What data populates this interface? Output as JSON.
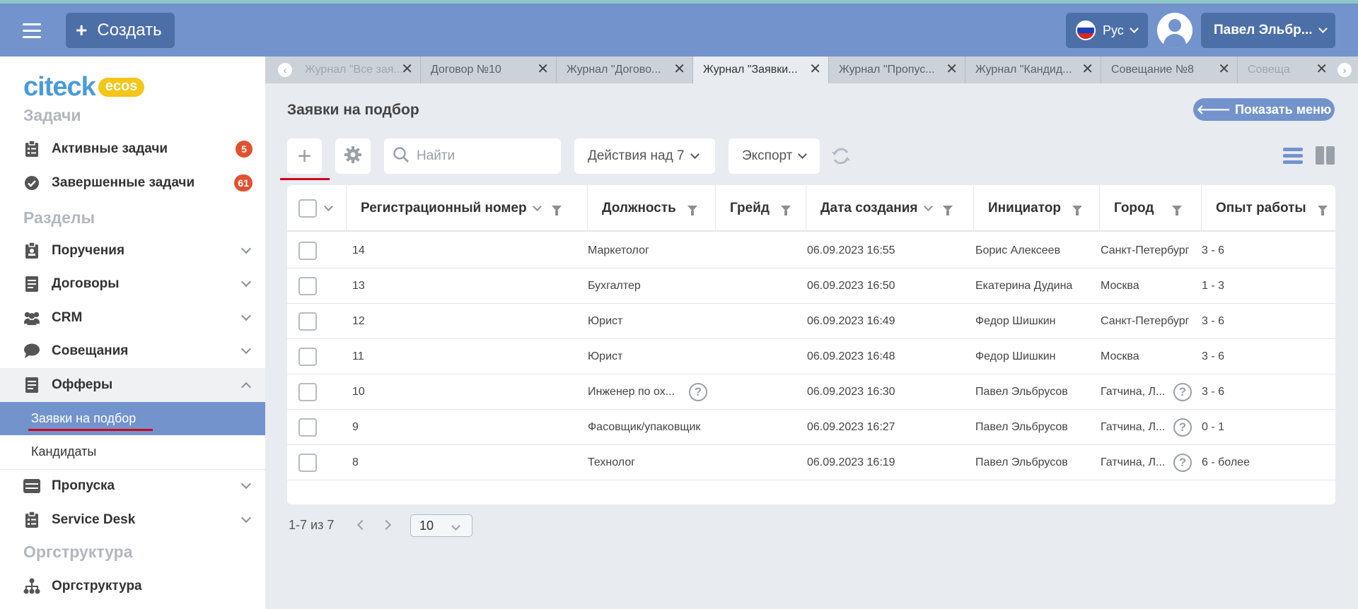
{
  "topbar": {
    "create_label": "Создать",
    "lang_label": "Рус",
    "user_label": "Павел Эльбр..."
  },
  "sidebar": {
    "logo_main": "citeck",
    "logo_badge": "ecos",
    "sections": {
      "tasks": "Задачи",
      "sections": "Разделы",
      "org": "Оргструктура"
    },
    "items": {
      "active_tasks": {
        "label": "Активные задачи",
        "badge": "5"
      },
      "done_tasks": {
        "label": "Завершенные задачи",
        "badge": "61"
      },
      "assignments": {
        "label": "Поручения"
      },
      "contracts": {
        "label": "Договоры"
      },
      "crm": {
        "label": "CRM"
      },
      "meetings": {
        "label": "Совещания"
      },
      "offers": {
        "label": "Офферы"
      },
      "requests": {
        "label": "Заявки на подбор"
      },
      "candidates": {
        "label": "Кандидаты"
      },
      "passes": {
        "label": "Пропуска"
      },
      "service_desk": {
        "label": "Service Desk"
      },
      "orgstructure": {
        "label": "Оргструктура"
      }
    }
  },
  "tabs": [
    {
      "label": "Журнал \"Все зая..."
    },
    {
      "label": "Договор №10"
    },
    {
      "label": "Журнал \"Догово..."
    },
    {
      "label": "Журнал \"Заявки..."
    },
    {
      "label": "Журнал \"Пропус..."
    },
    {
      "label": "Журнал \"Кандид..."
    },
    {
      "label": "Совещание №8"
    },
    {
      "label": "Совеща"
    }
  ],
  "main": {
    "title": "Заявки на подбор",
    "show_menu_label": "Показать меню",
    "search_placeholder": "Найти",
    "actions_label": "Действия над 7",
    "export_label": "Экспорт"
  },
  "table": {
    "columns": {
      "reg": "Регистрационный номер",
      "position": "Должность",
      "grade": "Грейд",
      "created": "Дата создания",
      "initiator": "Инициатор",
      "city": "Город",
      "experience": "Опыт работы"
    },
    "rows": [
      {
        "reg": "14",
        "position": "Маркетолог",
        "created": "06.09.2023 16:55",
        "initiator": "Борис Алексеев",
        "city": "Санкт-Петербург",
        "experience": "3 - 6"
      },
      {
        "reg": "13",
        "position": "Бухгалтер",
        "created": "06.09.2023 16:50",
        "initiator": "Екатерина Дудина",
        "city": "Москва",
        "experience": "1 - 3"
      },
      {
        "reg": "12",
        "position": "Юрист",
        "created": "06.09.2023 16:49",
        "initiator": "Федор Шишкин",
        "city": "Санкт-Петербург",
        "experience": "3 - 6"
      },
      {
        "reg": "11",
        "position": "Юрист",
        "created": "06.09.2023 16:48",
        "initiator": "Федор Шишкин",
        "city": "Москва",
        "experience": "3 - 6"
      },
      {
        "reg": "10",
        "position": "Инженер по ох...",
        "created": "06.09.2023 16:30",
        "initiator": "Павел Эльбрусов",
        "city": "Гатчина, Л...",
        "experience": "3 - 6"
      },
      {
        "reg": "9",
        "position": "Фасовщик/упаковщик",
        "created": "06.09.2023 16:27",
        "initiator": "Павел Эльбрусов",
        "city": "Гатчина, Л...",
        "experience": "0 - 1"
      },
      {
        "reg": "8",
        "position": "Технолог",
        "created": "06.09.2023 16:19",
        "initiator": "Павел Эльбрусов",
        "city": "Гатчина, Л...",
        "experience": "6 - более"
      }
    ]
  },
  "pagination": {
    "range_label": "1-7 из 7",
    "page_size": "10"
  },
  "colors": {
    "topbar": "#7393cc",
    "accent_dark": "#4d6fa8",
    "badge": "#e0522f",
    "underline": "#d0021b"
  }
}
